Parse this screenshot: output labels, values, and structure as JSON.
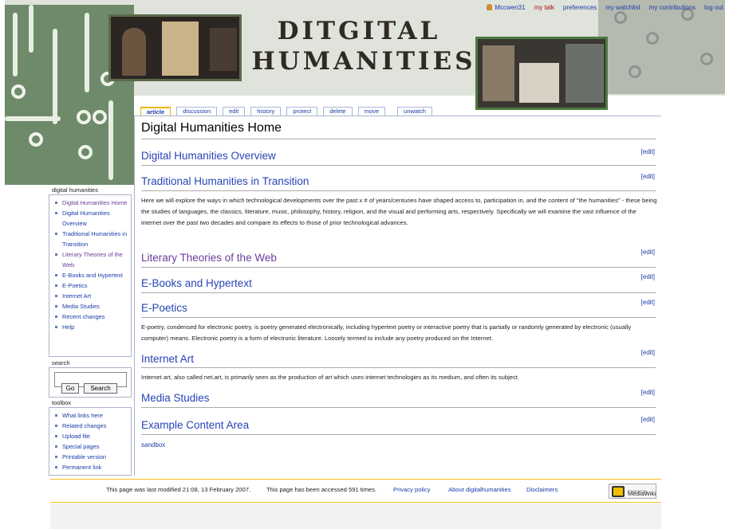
{
  "site": {
    "title_line1": "DITGITAL",
    "title_line2": "HUMANITIES"
  },
  "personal_tools": {
    "user": "Mccwen31",
    "talk": "my talk",
    "preferences": "preferences",
    "watchlist": "my watchlist",
    "contributions": "my contributions",
    "logout": "log out"
  },
  "tabs": [
    "article",
    "discussion",
    "edit",
    "history",
    "protect",
    "delete",
    "move",
    "unwatch"
  ],
  "page": {
    "title": "Digital Humanities Home",
    "edit_label": "[edit]",
    "sections": {
      "overview": "Digital Humanities Overview",
      "traditional": "Traditional Humanities in Transition",
      "traditional_text": "Here we will explore the ways in which technological developments over the past x # of years/centuries have shaped access to, participation in, and the content of \"the humanities\" - these being the studies of languages, the classics, literature, music, philosophy, history, religion, and the visual and performing arts, respectively. Specifically we will examine the vast influence of the internet over the past two decades and compare its effects to those of prior technological advances.",
      "literary": "Literary Theories of the Web",
      "ebooks": "E-Books and Hypertext",
      "epoetics": "E-Poetics",
      "epoetics_text": "E-poetry, condensed for electronic poetry, is poetry generated electronically, including hypertext poetry or interactive poetry that is partially or randomly generated by electronic (usually computer) means. Electronic poetry is a form of electronic literature. Loosely termed to include any poetry produced on the Internet.",
      "internet_art": "Internet Art",
      "internet_art_text": "Internet art, also called net.art, is primarily seen as the production of art which uses internet technologies as its medium, and often its subject.",
      "media": "Media Studies",
      "example": "Example Content Area"
    },
    "sandbox": "sandbox"
  },
  "sidebar": {
    "navigation_title": "digital humanities",
    "nav_items": [
      "Digital Humanities Home",
      "Digital Humanities Overview",
      "Traditional Humanities in Transition",
      "Literary Theories of the Web",
      "E-Books and Hypertext",
      "E-Poetics",
      "Internet Art",
      "Media Studies",
      "Recent changes",
      "Help"
    ],
    "search_title": "search",
    "search_value": "",
    "go_label": "Go",
    "search_label": "Search",
    "toolbox_title": "toolbox",
    "toolbox_items": [
      "What links here",
      "Related changes",
      "Upload file",
      "Special pages",
      "Printable version",
      "Permanent link"
    ]
  },
  "footer": {
    "last_modified": "This page was last modified 21:08, 13 February 2007.",
    "accessed": "This page has been accessed 591 times.",
    "privacy": "Privacy policy",
    "about": "About digitalhumanities",
    "disclaimers": "Disclaimers",
    "powered_small": "Powered By",
    "powered": "MediaWiki"
  },
  "colors": {
    "link": "#1a3ca8",
    "visited_link": "#6a3d9a",
    "new_link": "#b01010",
    "footer_rule": "#fabd23"
  }
}
